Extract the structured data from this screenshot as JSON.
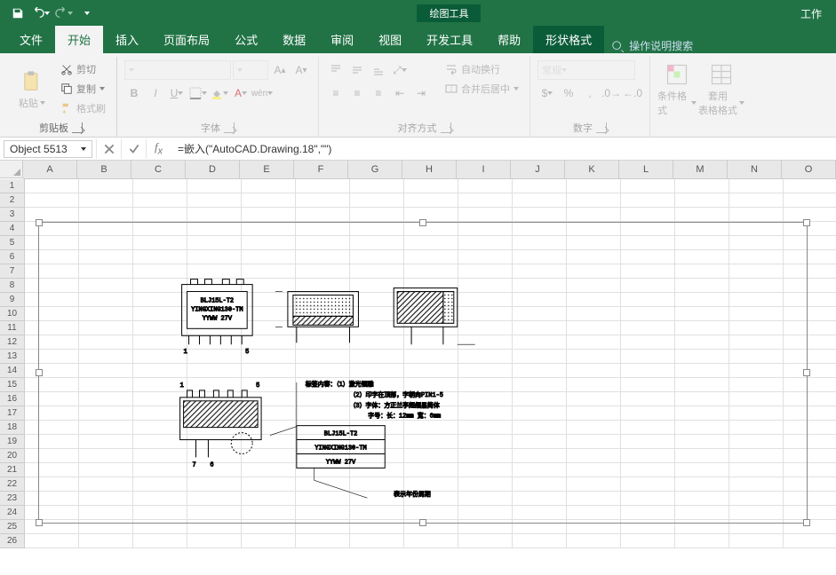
{
  "qat": {
    "save": "保存",
    "undo": "撤销",
    "redo": "重做"
  },
  "context_tool": {
    "title": "绘图工具",
    "tab": "形状格式"
  },
  "titlebar_right": "工作",
  "tabs": {
    "file": "文件",
    "home": "开始",
    "insert": "插入",
    "page_layout": "页面布局",
    "formulas": "公式",
    "data": "数据",
    "review": "审阅",
    "view": "视图",
    "developer": "开发工具",
    "help": "帮助"
  },
  "tell_me": "操作说明搜索",
  "ribbon_groups": {
    "clipboard": {
      "label": "剪贴板",
      "paste": "粘贴",
      "cut": "剪切",
      "copy": "复制",
      "format_painter": "格式刷"
    },
    "font": {
      "label": "字体"
    },
    "alignment": {
      "label": "对齐方式",
      "wrap": "自动换行",
      "merge": "合并后居中"
    },
    "number": {
      "label": "数字",
      "general": "常规"
    },
    "styles": {
      "conditional": "条件格式",
      "table": "套用\n表格格式"
    }
  },
  "name_box": "Object 5513",
  "formula": "=嵌入(\"AutoCAD.Drawing.18\",\"\")",
  "columns": [
    "A",
    "B",
    "C",
    "D",
    "E",
    "F",
    "G",
    "H",
    "I",
    "J",
    "K",
    "L",
    "M",
    "N",
    "O"
  ],
  "row_count": 26,
  "cad_labels": {
    "tag_title": "标签内容：",
    "line1": "（1）激光镭雕",
    "line2": "（2）印字在顶部，字朝向PIN1-5",
    "line3": "（3）字体：方正兰亭超细黑简体",
    "line4": "　　　字号：长：12mm  宽：6mm",
    "box_l1": "BLJ15L-T2",
    "box_l2": "YINGXING130-TM",
    "box_l3": "YYWW  27V",
    "date_note": "表示年份周期",
    "pin1": "1",
    "pin5": "5",
    "pin6": "6",
    "pin7": "7"
  }
}
